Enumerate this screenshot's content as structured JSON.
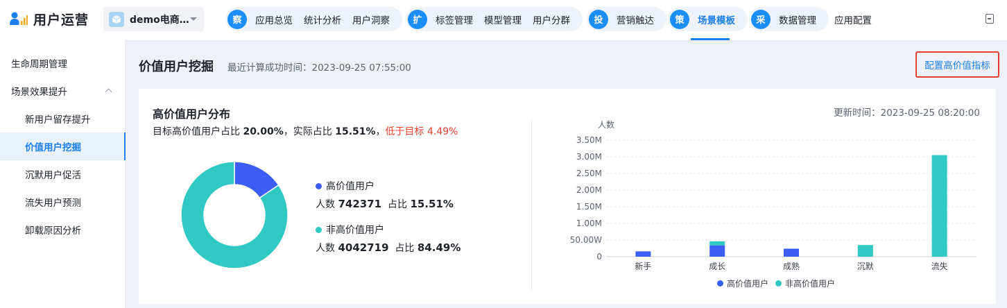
{
  "app": {
    "title": "用户运营",
    "current_app": "demo电商…"
  },
  "nav": {
    "groups": [
      {
        "badge": "察",
        "items": [
          "应用总览",
          "统计分析",
          "用户洞察"
        ]
      },
      {
        "badge": "扩",
        "items": [
          "标签管理",
          "模型管理",
          "用户分群"
        ]
      },
      {
        "badge": "投",
        "items": [
          "营销触达"
        ]
      },
      {
        "badge": "策",
        "items": [
          "场景模板"
        ]
      },
      {
        "badge": "采",
        "items": [
          "数据管理"
        ]
      }
    ],
    "plain": "应用配置",
    "active": "场景模板"
  },
  "sidebar": {
    "items": [
      {
        "label": "生命周期管理",
        "level": 1
      },
      {
        "label": "场景效果提升",
        "level": 1,
        "expanded": true
      },
      {
        "label": "新用户留存提升",
        "level": 2
      },
      {
        "label": "价值用户挖掘",
        "level": 2,
        "active": true
      },
      {
        "label": "沉默用户促活",
        "level": 2
      },
      {
        "label": "流失用户预测",
        "level": 2
      },
      {
        "label": "卸载原因分析",
        "level": 2
      }
    ]
  },
  "page": {
    "title": "价值用户挖掘",
    "calc_time": "最近计算成功时间：2023-09-25 07:55:00",
    "config_link": "配置高价值指标"
  },
  "card": {
    "title": "高价值用户分布",
    "updated": "更新时间：2023-09-25 08:20:00",
    "summary": {
      "prefix": "目标高价值用户占比 ",
      "target": "20.00%",
      "mid": "，实际占比 ",
      "actual": "15.51%",
      "sep": "，",
      "warn_label": "低于目标 ",
      "warn_value": "4.49%"
    }
  },
  "donut_data": {
    "segments": [
      {
        "name": "高价值用户",
        "count_label": "人数",
        "count": "742371",
        "ratio_label": "占比",
        "ratio": "15.51%",
        "fraction": 0.1551,
        "color": "#3d5ef5"
      },
      {
        "name": "非高价值用户",
        "count_label": "人数",
        "count": "4042719",
        "ratio_label": "占比",
        "ratio": "84.49%",
        "fraction": 0.8449,
        "color": "#2fc8c2"
      }
    ]
  },
  "chart_data": {
    "type": "bar",
    "stacked": true,
    "ylabel": "人数",
    "categories": [
      "新手",
      "成长",
      "成熟",
      "沉默",
      "流失"
    ],
    "series": [
      {
        "name": "高价值用户",
        "color": "#3d5ef5",
        "values": [
          160000,
          340000,
          240000,
          0,
          0
        ]
      },
      {
        "name": "非高价值用户",
        "color": "#2fc8c2",
        "values": [
          0,
          120000,
          0,
          350000,
          3050000
        ]
      }
    ],
    "yticks": [
      "0",
      "50.00W",
      "1.00M",
      "1.50M",
      "2.00M",
      "2.50M",
      "3.00M",
      "3.50M"
    ],
    "ylim": [
      0,
      3500000
    ],
    "legend_position": "bottom-center",
    "grid": true
  }
}
